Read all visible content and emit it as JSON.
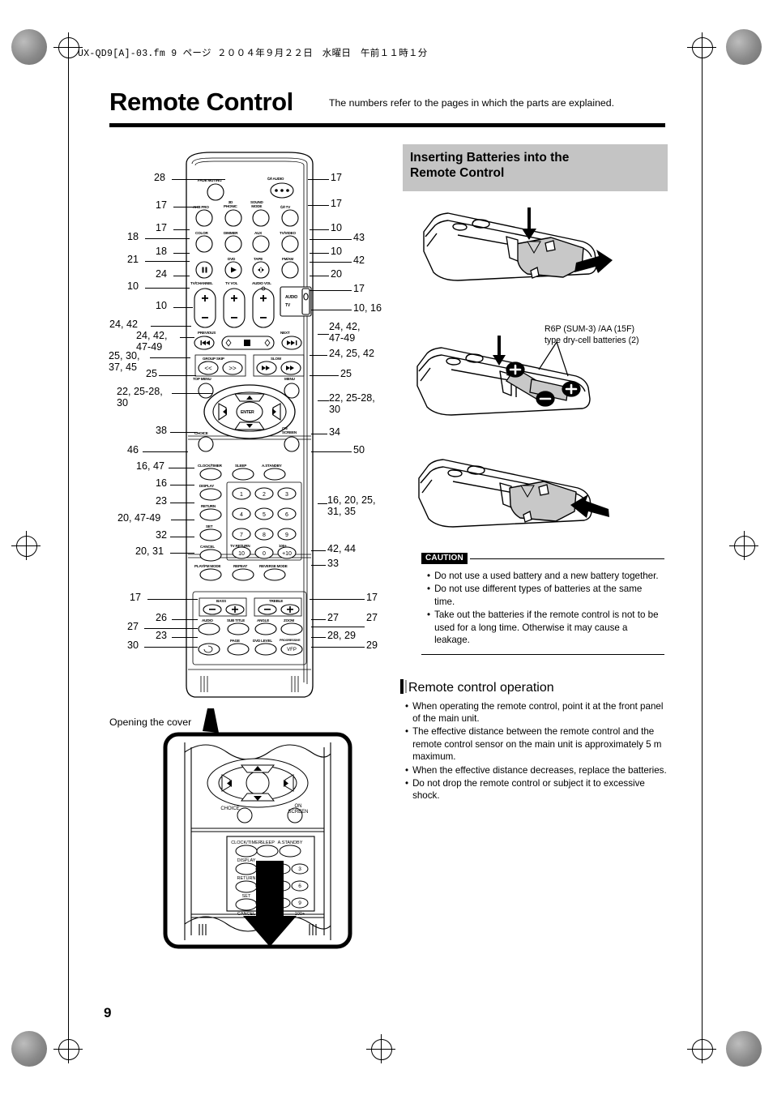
{
  "header": {
    "file_line": "UX-QD9[A]-03.fm  9 ページ  ２００４年９月２２日　水曜日　午前１１時１分",
    "title": "Remote Control",
    "note": "The numbers refer to the pages in which the parts are explained."
  },
  "page_number": "9",
  "right_column": {
    "section_title": "Inserting Batteries into the\nRemote Control",
    "battery_note": "R6P (SUM-3) /AA (15F)\ntype dry-cell batteries (2)",
    "caution_label": "CAUTION",
    "caution_items": [
      "Do not use a used battery and a new battery together.",
      "Do not use different types of batteries at the same time.",
      "Take out the batteries if the remote control is not to be used for a long time. Otherwise it may cause a leakage."
    ],
    "operation_title": "Remote control operation",
    "operation_items": [
      "When operating the remote control, point it at the front panel of the main unit.",
      "The effective distance between the remote control and the remote control sensor on the main unit is approximately 5 m maximum.",
      "When the effective distance decreases, replace the batteries.",
      "Do not drop the remote control or subject it to excessive shock."
    ]
  },
  "diagram": {
    "opening_cover_caption": "Opening the cover",
    "left_callouts": [
      {
        "id": "c-l-28",
        "text": "28"
      },
      {
        "id": "c-l-17a",
        "text": "17"
      },
      {
        "id": "c-l-17b",
        "text": "17"
      },
      {
        "id": "c-l-18a",
        "text": "18"
      },
      {
        "id": "c-l-18b",
        "text": "18"
      },
      {
        "id": "c-l-21",
        "text": "21"
      },
      {
        "id": "c-l-24",
        "text": "24"
      },
      {
        "id": "c-l-10a",
        "text": "10"
      },
      {
        "id": "c-l-10b",
        "text": "10"
      },
      {
        "id": "c-l-2442",
        "text": "24, 42"
      },
      {
        "id": "c-l-24424749",
        "text": "24, 42,\n47-49"
      },
      {
        "id": "c-l-25303745",
        "text": "25, 30,\n37, 45"
      },
      {
        "id": "c-l-25",
        "text": "25"
      },
      {
        "id": "c-l-2225283",
        "text": "22, 25-28,\n30"
      },
      {
        "id": "c-l-38",
        "text": "38"
      },
      {
        "id": "c-l-46",
        "text": "46"
      },
      {
        "id": "c-l-1647",
        "text": "16, 47"
      },
      {
        "id": "c-l-16",
        "text": "16"
      },
      {
        "id": "c-l-23a",
        "text": "23"
      },
      {
        "id": "c-l-204749",
        "text": "20, 47-49"
      },
      {
        "id": "c-l-32",
        "text": "32"
      },
      {
        "id": "c-l-2031",
        "text": "20, 31"
      },
      {
        "id": "c-l-17c",
        "text": "17"
      },
      {
        "id": "c-l-26",
        "text": "26"
      },
      {
        "id": "c-l-27",
        "text": "27"
      },
      {
        "id": "c-l-23b",
        "text": "23"
      },
      {
        "id": "c-l-30",
        "text": "30"
      }
    ],
    "right_callouts": [
      {
        "id": "c-r-17a",
        "text": "17"
      },
      {
        "id": "c-r-17b",
        "text": "17"
      },
      {
        "id": "c-r-10a",
        "text": "10"
      },
      {
        "id": "c-r-43",
        "text": "43"
      },
      {
        "id": "c-r-10b",
        "text": "10"
      },
      {
        "id": "c-r-42",
        "text": "42"
      },
      {
        "id": "c-r-20",
        "text": "20"
      },
      {
        "id": "c-r-17c",
        "text": "17"
      },
      {
        "id": "c-r-1016",
        "text": "10, 16"
      },
      {
        "id": "c-r-24424749",
        "text": "24, 42,\n47-49"
      },
      {
        "id": "c-r-242542",
        "text": "24, 25, 42"
      },
      {
        "id": "c-r-25",
        "text": "25"
      },
      {
        "id": "c-r-22252830",
        "text": "22, 25-28,\n30"
      },
      {
        "id": "c-r-34",
        "text": "34"
      },
      {
        "id": "c-r-50",
        "text": "50"
      },
      {
        "id": "c-r-1620253135",
        "text": "16, 20, 25,\n31, 35"
      },
      {
        "id": "c-r-4244",
        "text": "42, 44"
      },
      {
        "id": "c-r-33",
        "text": "33"
      },
      {
        "id": "c-r-17d",
        "text": "17"
      },
      {
        "id": "c-r-27a",
        "text": "27"
      },
      {
        "id": "c-r-27b",
        "text": "27"
      },
      {
        "id": "c-r-2829",
        "text": "28, 29"
      },
      {
        "id": "c-r-29",
        "text": "29"
      }
    ],
    "button_labels": {
      "fade_muting": "FADE MUTING",
      "power_audio": "⏻/I  AUDIO",
      "ahb_pro": "AHB PRO",
      "three_d_phonic": "3D\nPHONIC",
      "sound_mode": "SOUND\nMODE",
      "power_tv": "⏻/I TV",
      "color": "COLOR",
      "dimmer": "DIMMER",
      "aux": "AUX",
      "tv_video": "TV/VIDEO",
      "dvd": "DVD",
      "tape": "TAPE",
      "fm_am": "FM/AM",
      "tv_channel": "TV/CHANNEL",
      "tv_vol": "TV VOL",
      "audio_vol": "AUDIO VOL",
      "audio_tv_switch": "AUDIO\nTV",
      "previous": "PREVIOUS",
      "next": "NEXT",
      "group_skip": "GROUP SKIP",
      "slow": "SLOW",
      "top_menu": "TOP MENU",
      "menu": "MENU",
      "enter": "ENTER",
      "choice": "CHOICE",
      "on_screen": "ON\nSCREEN",
      "clock_timer": "CLOCK/TIMER",
      "sleep": "SLEEP",
      "a_standby": "A.STANDBY",
      "display": "DISPLAY",
      "return": "RETURN",
      "set": "SET",
      "cancel": "CANCEL",
      "play_fm_mode": "PLAY/FM MODE",
      "repeat": "REPEAT",
      "reverse_mode": "REVERSE MODE",
      "tv_return": "TV RETURN",
      "hundred_plus": "100+",
      "bass": "BASS",
      "treble": "TREBLE",
      "audio": "AUDIO",
      "sub_title": "SUB TITLE",
      "angle": "ANGLE",
      "zoom": "ZOOM",
      "page": "PAGE",
      "dvd_level": "DVD LEVEL",
      "vfp": "VFP",
      "vfp_note": "PROGRESSIVE"
    },
    "numeric_keys": [
      "1",
      "2",
      "3",
      "4",
      "5",
      "6",
      "7",
      "8",
      "9",
      "10",
      "0",
      "+10"
    ],
    "minus": "–",
    "plus": "+"
  }
}
